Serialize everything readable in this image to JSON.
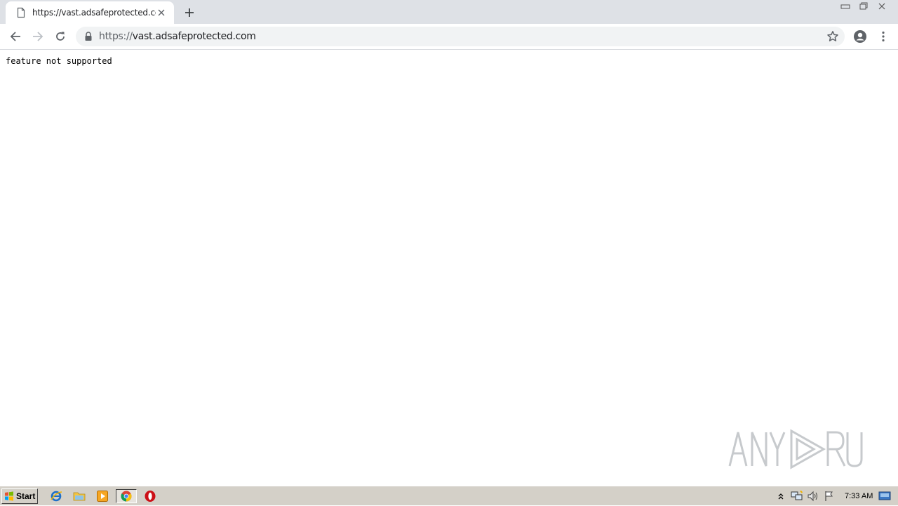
{
  "browser": {
    "tab": {
      "title": "https://vast.adsafeprotected.com",
      "favicon": "page-icon"
    },
    "new_tab_icon": "plus-icon",
    "window_controls": [
      "minimize-icon",
      "restore-icon",
      "close-icon"
    ],
    "toolbar": {
      "back_icon": "arrow-left-icon",
      "forward_icon": "arrow-right-icon",
      "reload_icon": "reload-icon",
      "url_scheme": "https://",
      "url_host": "vast.adsafeprotected.com",
      "secure_icon": "lock-icon",
      "bookmark_icon": "star-icon",
      "profile_icon": "account-icon",
      "menu_icon": "kebab-menu-icon"
    }
  },
  "page": {
    "body_text": "feature not supported"
  },
  "watermark": {
    "text": "ANY RUN"
  },
  "taskbar": {
    "start_label": "Start",
    "pinned": [
      "internet-explorer-icon",
      "folder-icon",
      "media-player-icon",
      "chrome-icon",
      "opera-icon"
    ],
    "tray_icons": [
      "expand-tray-icon",
      "network-icon",
      "volume-icon",
      "flag-icon"
    ],
    "clock": "7:33 AM"
  },
  "colors": {
    "tabstrip_bg": "#dee1e6",
    "omnibox_bg": "#f1f3f4",
    "taskbar_bg": "#d4d0c8"
  }
}
